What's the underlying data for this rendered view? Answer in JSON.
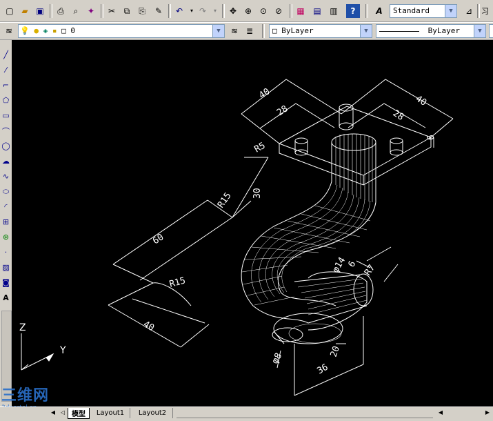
{
  "toolbar": {
    "text_style": "Standard",
    "right_partial": "习"
  },
  "layers": {
    "current_layer": "0",
    "color": "ByLayer",
    "linetype": "ByLayer"
  },
  "dimensions": {
    "top_left_40": "40",
    "top_right_40": "40",
    "top_left_28": "28",
    "top_right_28": "28",
    "height_6": "6",
    "r5": "R5",
    "r15_upper": "R15",
    "dim_30": "30",
    "dim_60": "60",
    "r15_lower": "R15",
    "dim_40_bottom": "40",
    "phi14": "φ14",
    "dim_6_right": "6",
    "r7": "R7",
    "phi8": "φ8",
    "dim_20": "20",
    "dim_36": "36"
  },
  "ucs": {
    "z_label": "Z",
    "y_label": "Y"
  },
  "tabs": {
    "model": "模型",
    "layout1": "Layout1",
    "layout2": "Layout2"
  },
  "watermark": {
    "main": "三维网",
    "sub": "3dportal.cn"
  },
  "colors": {
    "canvas": "#000000",
    "geometry": "#ffffff",
    "watermark": "#2a6fc9"
  }
}
